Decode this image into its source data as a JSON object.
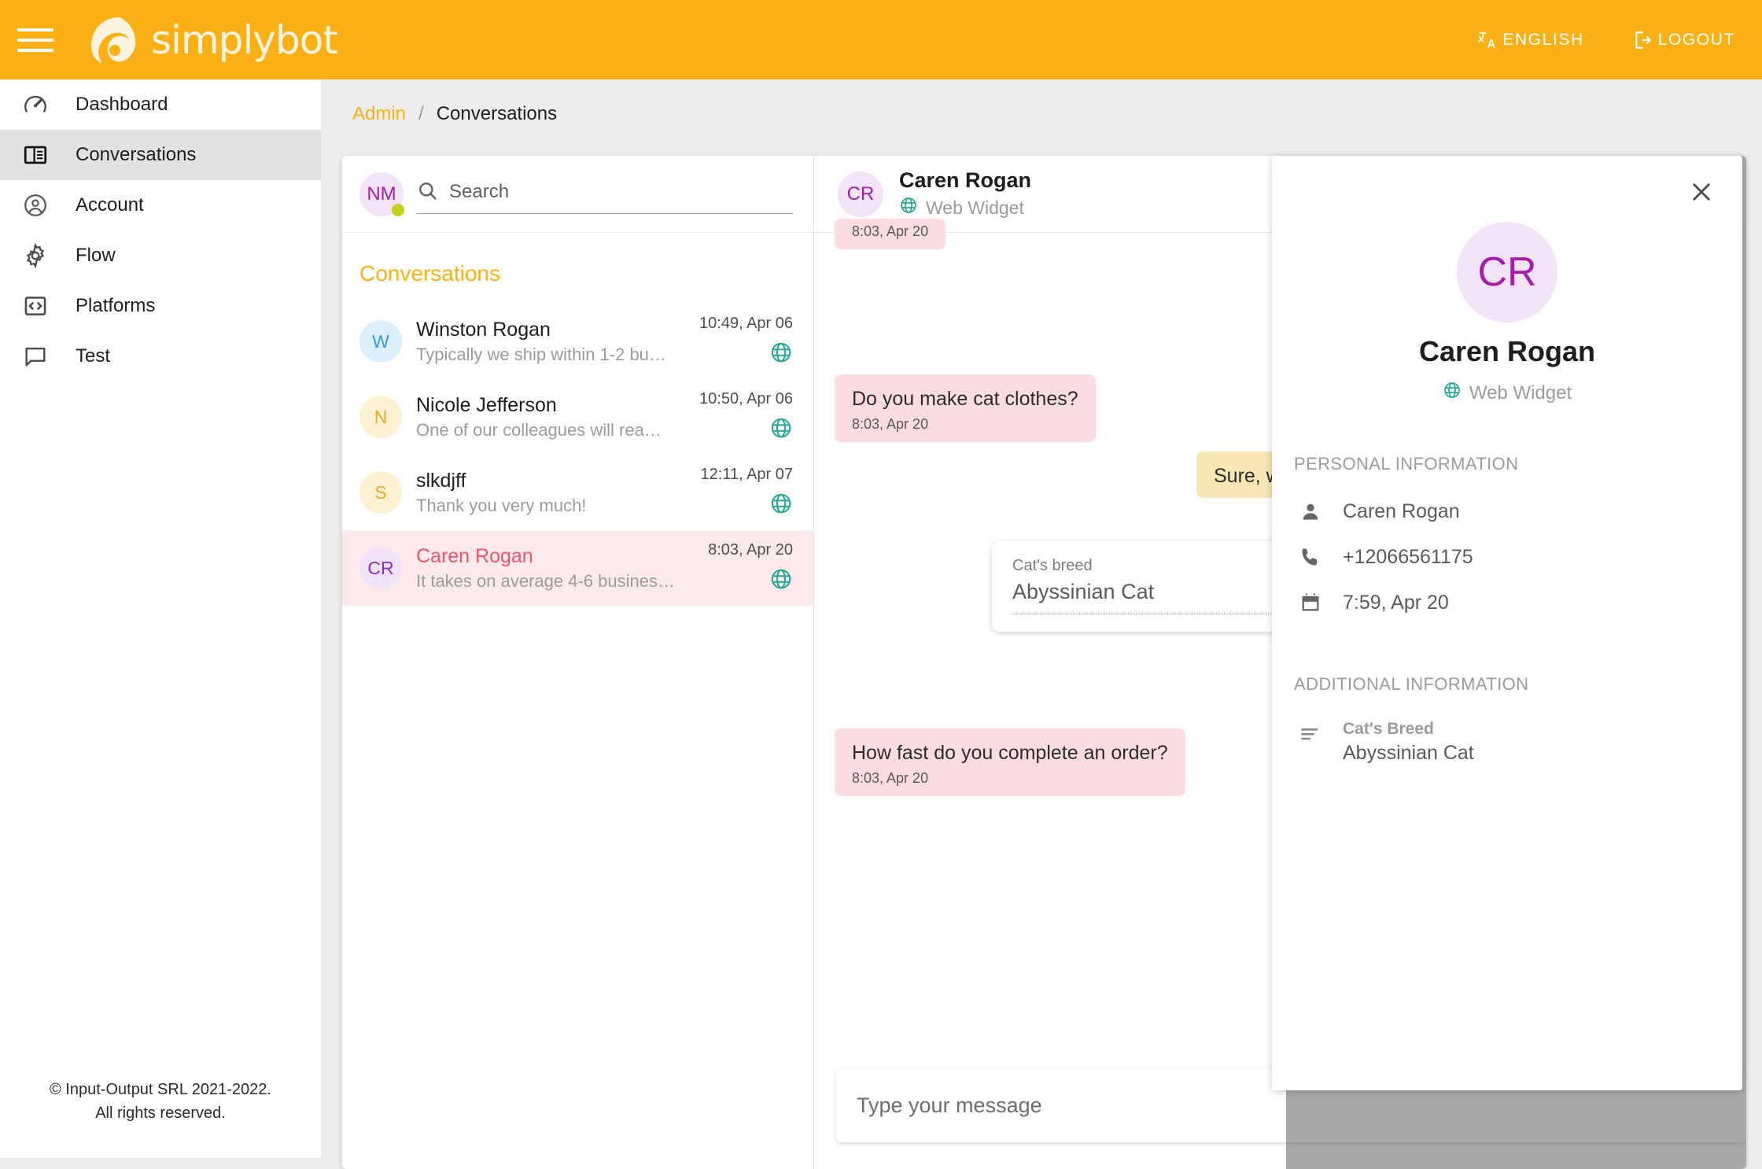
{
  "topbar": {
    "menu_icon": "hamburger-icon",
    "brand": "simplybot",
    "language_label": "ENGLISH",
    "language_icon": "translate-icon",
    "logout_label": "LOGOUT",
    "logout_icon": "logout-icon",
    "background": "#fbb116"
  },
  "sidebar": {
    "items": [
      {
        "label": "Dashboard",
        "icon": "speedometer-icon",
        "active": false
      },
      {
        "label": "Conversations",
        "icon": "panels-icon",
        "active": true
      },
      {
        "label": "Account",
        "icon": "account-circle-icon",
        "active": false
      },
      {
        "label": "Flow",
        "icon": "gear-icon",
        "active": false
      },
      {
        "label": "Platforms",
        "icon": "code-brackets-icon",
        "active": false
      },
      {
        "label": "Test",
        "icon": "chat-bubble-icon",
        "active": false
      }
    ],
    "footer_line1": "© Input-Output SRL 2021-2022.",
    "footer_line2": "All rights reserved."
  },
  "breadcrumb": {
    "root": "Admin",
    "separator": "/",
    "current": "Conversations"
  },
  "conversation_list": {
    "me_initials": "NM",
    "status_color": "#c3d119",
    "search_placeholder": "Search",
    "search_value": "",
    "search_icon": "search-icon",
    "title": "Conversations",
    "rows": [
      {
        "initials": "W",
        "name": "Winston Rogan",
        "preview": "Typically we ship within 1-2 bu…",
        "time": "10:49, Apr 06",
        "channel_icon": "globe-icon",
        "avatar_bg": "#ddeefc",
        "avatar_fg": "#2f9bea",
        "selected": false
      },
      {
        "initials": "N",
        "name": "Nicole Jefferson",
        "preview": "One of our colleagues will rea…",
        "time": "10:50, Apr 06",
        "channel_icon": "globe-icon",
        "avatar_bg": "#fdf1d2",
        "avatar_fg": "#e8a823",
        "selected": false
      },
      {
        "initials": "S",
        "name": "slkdjff",
        "preview": "Thank you very much!",
        "time": "12:11, Apr 07",
        "channel_icon": "globe-icon",
        "avatar_bg": "#fdf1d2",
        "avatar_fg": "#e8a823",
        "selected": false
      },
      {
        "initials": "CR",
        "name": "Caren Rogan",
        "preview": "It takes on average 4-6 busines…",
        "time": "8:03, Apr 20",
        "channel_icon": "globe-icon",
        "avatar_bg": "#f0e2f7",
        "avatar_fg": "#8b2fb3",
        "selected": true
      }
    ]
  },
  "chat": {
    "header": {
      "initials": "CR",
      "name": "Caren Rogan",
      "platform": "Web Widget",
      "platform_icon": "globe-icon"
    },
    "messages": [
      {
        "direction": "in",
        "text": "",
        "time": "8:03, Apr 20"
      },
      {
        "direction": "in",
        "text": "Do you make cat clothes?",
        "time": "8:03, Apr 20"
      },
      {
        "direction": "out",
        "text": "Sure, we… breed?",
        "time": ""
      },
      {
        "direction": "in",
        "text": "How fast do you complete an order?",
        "time": "8:03, Apr 20"
      }
    ],
    "form_card": {
      "label": "Cat's breed",
      "value": "Abyssinian Cat"
    },
    "composer_placeholder": "Type your message",
    "composer_value": ""
  },
  "drawer": {
    "close_icon": "close-icon",
    "initials": "CR",
    "name": "Caren Rogan",
    "platform": "Web Widget",
    "platform_icon": "globe-icon",
    "personal_title": "PERSONAL INFORMATION",
    "personal": [
      {
        "icon": "person-icon",
        "value": "Caren Rogan"
      },
      {
        "icon": "phone-icon",
        "value": "+12066561175"
      },
      {
        "icon": "calendar-icon",
        "value": "7:59, Apr 20"
      }
    ],
    "additional_title": "ADDITIONAL INFORMATION",
    "additional": [
      {
        "icon": "subject-lines-icon",
        "label": "Cat's Breed",
        "value": "Abyssinian Cat"
      }
    ]
  }
}
